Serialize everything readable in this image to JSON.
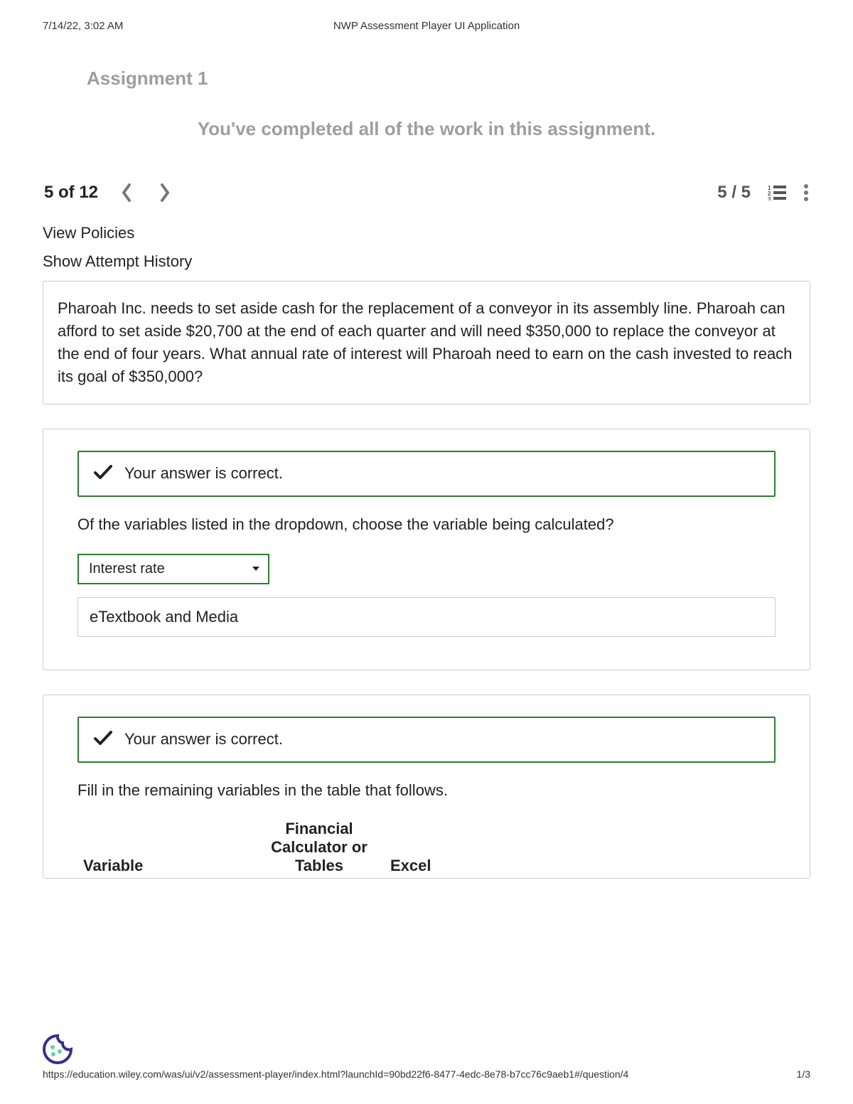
{
  "print": {
    "timestamp": "7/14/22, 3:02 AM",
    "title": "NWP Assessment Player UI Application"
  },
  "assignment_title": "Assignment 1",
  "completed": "You've completed all of the work in this assignment.",
  "progress": {
    "label": "5 of 12"
  },
  "score": {
    "label": "5 / 5"
  },
  "links": {
    "policies": "View Policies",
    "history": "Show Attempt History"
  },
  "question": "Pharoah Inc. needs to set aside cash for the replacement of a conveyor in its assembly line. Pharoah can afford to set aside $20,700 at the end of each quarter and will need $350,000 to replace the conveyor at the end of four years. What annual rate of interest will Pharoah need to earn on the cash invested to reach its goal of $350,000?",
  "part1": {
    "correct_msg": "Your answer is correct.",
    "prompt": "Of the variables listed in the dropdown, choose the variable being calculated?",
    "selected": "Interest rate",
    "etext": "eTextbook and Media"
  },
  "part2": {
    "correct_msg": "Your answer is correct.",
    "prompt": "Fill in the remaining variables in the table that follows.",
    "headers": {
      "variable": "Variable",
      "fin": "Financial Calculator or Tables",
      "excel": "Excel"
    }
  },
  "footer": {
    "url": "https://education.wiley.com/was/ui/v2/assessment-player/index.html?launchId=90bd22f6-8477-4edc-8e78-b7cc76c9aeb1#/question/4",
    "page": "1/3"
  }
}
